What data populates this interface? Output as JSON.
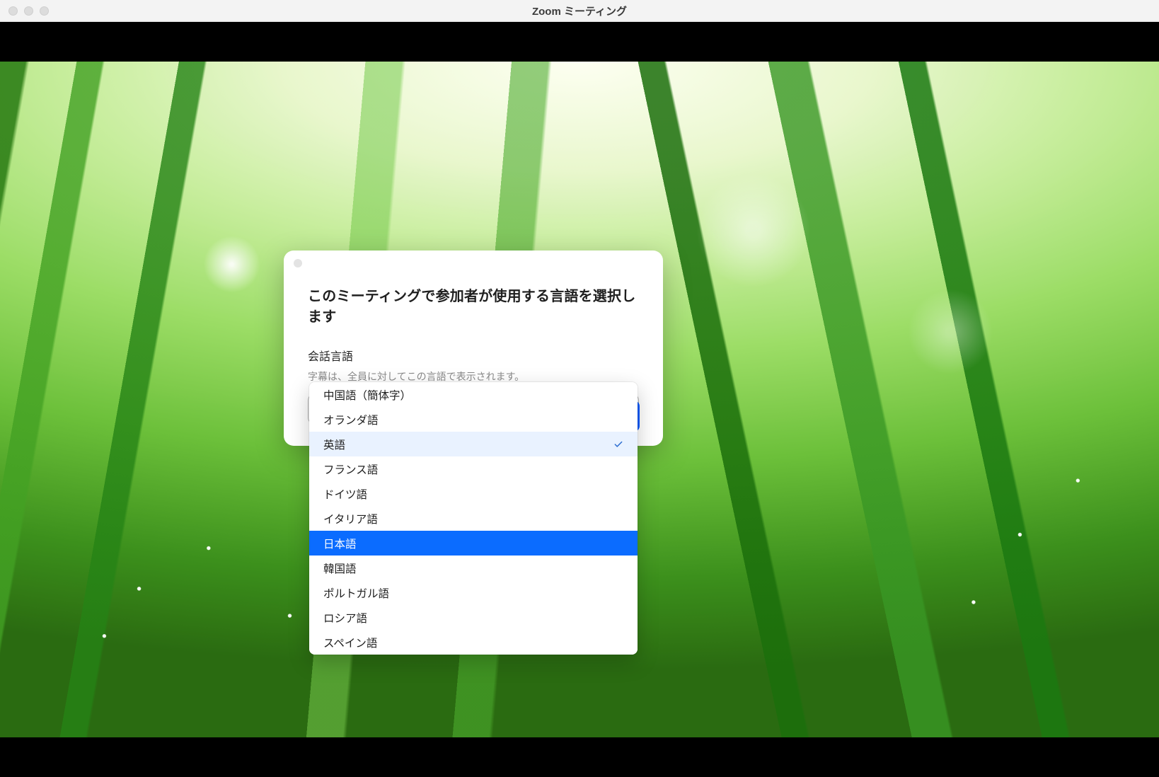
{
  "window": {
    "title": "Zoom ミーティング"
  },
  "modal": {
    "title": "このミーティングで参加者が使用する言語を選択します",
    "label": "会話言語",
    "sub": "字幕は、全員に対してこの言語で表示されます。",
    "selected": "英語"
  },
  "options": [
    {
      "label": "中国語（簡体字）"
    },
    {
      "label": "オランダ語"
    },
    {
      "label": "英語",
      "selected": true
    },
    {
      "label": "フランス語"
    },
    {
      "label": "ドイツ語"
    },
    {
      "label": "イタリア語"
    },
    {
      "label": "日本語",
      "hover": true
    },
    {
      "label": "韓国語"
    },
    {
      "label": "ポルトガル語"
    },
    {
      "label": "ロシア語"
    },
    {
      "label": "スペイン語"
    }
  ],
  "colors": {
    "accent": "#0b6cff"
  }
}
